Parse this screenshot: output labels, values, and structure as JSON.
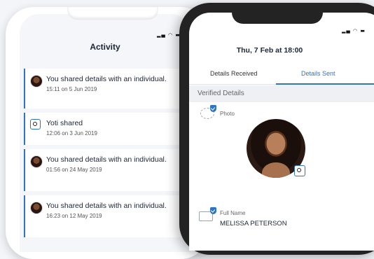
{
  "activity_screen": {
    "status_icons": "▂▄ ◠ ▬",
    "title": "Activity",
    "items": [
      {
        "avatar": "person-avatar",
        "title": "You shared details with an individual.",
        "time": "15:11 on 5 Jun 2019"
      },
      {
        "avatar": "yoti-logo",
        "title": "Yoti shared",
        "time": "12:06 on 3 Jun 2019"
      },
      {
        "avatar": "person-avatar",
        "title": "You shared details with an individual.",
        "time": "01:56 on 24 May 2019"
      },
      {
        "avatar": "person-avatar",
        "title": "You shared details with an individual.",
        "time": "16:23 on 12 May 2019"
      }
    ]
  },
  "details_screen": {
    "status_icons": "▂▄ ◠ ▬",
    "title": "Thu, 7 Feb at 18:00",
    "tabs": [
      {
        "label": "Details Received",
        "active": false
      },
      {
        "label": "Details Sent",
        "active": true
      }
    ],
    "section": "Verified Details",
    "photo_label": "Photo",
    "full_name_label": "Full Name",
    "full_name_value": "MELISSA PETERSON"
  },
  "colors": {
    "accent": "#2d74c7",
    "dark_phone": "#232323"
  }
}
